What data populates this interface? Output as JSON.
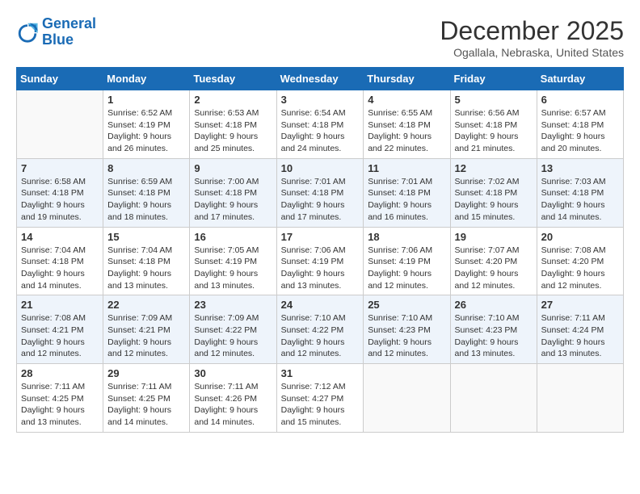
{
  "logo": {
    "line1": "General",
    "line2": "Blue"
  },
  "title": "December 2025",
  "location": "Ogallala, Nebraska, United States",
  "weekdays": [
    "Sunday",
    "Monday",
    "Tuesday",
    "Wednesday",
    "Thursday",
    "Friday",
    "Saturday"
  ],
  "weeks": [
    [
      {
        "day": "",
        "sunrise": "",
        "sunset": "",
        "daylight": ""
      },
      {
        "day": "1",
        "sunrise": "Sunrise: 6:52 AM",
        "sunset": "Sunset: 4:19 PM",
        "daylight": "Daylight: 9 hours and 26 minutes."
      },
      {
        "day": "2",
        "sunrise": "Sunrise: 6:53 AM",
        "sunset": "Sunset: 4:18 PM",
        "daylight": "Daylight: 9 hours and 25 minutes."
      },
      {
        "day": "3",
        "sunrise": "Sunrise: 6:54 AM",
        "sunset": "Sunset: 4:18 PM",
        "daylight": "Daylight: 9 hours and 24 minutes."
      },
      {
        "day": "4",
        "sunrise": "Sunrise: 6:55 AM",
        "sunset": "Sunset: 4:18 PM",
        "daylight": "Daylight: 9 hours and 22 minutes."
      },
      {
        "day": "5",
        "sunrise": "Sunrise: 6:56 AM",
        "sunset": "Sunset: 4:18 PM",
        "daylight": "Daylight: 9 hours and 21 minutes."
      },
      {
        "day": "6",
        "sunrise": "Sunrise: 6:57 AM",
        "sunset": "Sunset: 4:18 PM",
        "daylight": "Daylight: 9 hours and 20 minutes."
      }
    ],
    [
      {
        "day": "7",
        "sunrise": "Sunrise: 6:58 AM",
        "sunset": "Sunset: 4:18 PM",
        "daylight": "Daylight: 9 hours and 19 minutes."
      },
      {
        "day": "8",
        "sunrise": "Sunrise: 6:59 AM",
        "sunset": "Sunset: 4:18 PM",
        "daylight": "Daylight: 9 hours and 18 minutes."
      },
      {
        "day": "9",
        "sunrise": "Sunrise: 7:00 AM",
        "sunset": "Sunset: 4:18 PM",
        "daylight": "Daylight: 9 hours and 17 minutes."
      },
      {
        "day": "10",
        "sunrise": "Sunrise: 7:01 AM",
        "sunset": "Sunset: 4:18 PM",
        "daylight": "Daylight: 9 hours and 17 minutes."
      },
      {
        "day": "11",
        "sunrise": "Sunrise: 7:01 AM",
        "sunset": "Sunset: 4:18 PM",
        "daylight": "Daylight: 9 hours and 16 minutes."
      },
      {
        "day": "12",
        "sunrise": "Sunrise: 7:02 AM",
        "sunset": "Sunset: 4:18 PM",
        "daylight": "Daylight: 9 hours and 15 minutes."
      },
      {
        "day": "13",
        "sunrise": "Sunrise: 7:03 AM",
        "sunset": "Sunset: 4:18 PM",
        "daylight": "Daylight: 9 hours and 14 minutes."
      }
    ],
    [
      {
        "day": "14",
        "sunrise": "Sunrise: 7:04 AM",
        "sunset": "Sunset: 4:18 PM",
        "daylight": "Daylight: 9 hours and 14 minutes."
      },
      {
        "day": "15",
        "sunrise": "Sunrise: 7:04 AM",
        "sunset": "Sunset: 4:18 PM",
        "daylight": "Daylight: 9 hours and 13 minutes."
      },
      {
        "day": "16",
        "sunrise": "Sunrise: 7:05 AM",
        "sunset": "Sunset: 4:19 PM",
        "daylight": "Daylight: 9 hours and 13 minutes."
      },
      {
        "day": "17",
        "sunrise": "Sunrise: 7:06 AM",
        "sunset": "Sunset: 4:19 PM",
        "daylight": "Daylight: 9 hours and 13 minutes."
      },
      {
        "day": "18",
        "sunrise": "Sunrise: 7:06 AM",
        "sunset": "Sunset: 4:19 PM",
        "daylight": "Daylight: 9 hours and 12 minutes."
      },
      {
        "day": "19",
        "sunrise": "Sunrise: 7:07 AM",
        "sunset": "Sunset: 4:20 PM",
        "daylight": "Daylight: 9 hours and 12 minutes."
      },
      {
        "day": "20",
        "sunrise": "Sunrise: 7:08 AM",
        "sunset": "Sunset: 4:20 PM",
        "daylight": "Daylight: 9 hours and 12 minutes."
      }
    ],
    [
      {
        "day": "21",
        "sunrise": "Sunrise: 7:08 AM",
        "sunset": "Sunset: 4:21 PM",
        "daylight": "Daylight: 9 hours and 12 minutes."
      },
      {
        "day": "22",
        "sunrise": "Sunrise: 7:09 AM",
        "sunset": "Sunset: 4:21 PM",
        "daylight": "Daylight: 9 hours and 12 minutes."
      },
      {
        "day": "23",
        "sunrise": "Sunrise: 7:09 AM",
        "sunset": "Sunset: 4:22 PM",
        "daylight": "Daylight: 9 hours and 12 minutes."
      },
      {
        "day": "24",
        "sunrise": "Sunrise: 7:10 AM",
        "sunset": "Sunset: 4:22 PM",
        "daylight": "Daylight: 9 hours and 12 minutes."
      },
      {
        "day": "25",
        "sunrise": "Sunrise: 7:10 AM",
        "sunset": "Sunset: 4:23 PM",
        "daylight": "Daylight: 9 hours and 12 minutes."
      },
      {
        "day": "26",
        "sunrise": "Sunrise: 7:10 AM",
        "sunset": "Sunset: 4:23 PM",
        "daylight": "Daylight: 9 hours and 13 minutes."
      },
      {
        "day": "27",
        "sunrise": "Sunrise: 7:11 AM",
        "sunset": "Sunset: 4:24 PM",
        "daylight": "Daylight: 9 hours and 13 minutes."
      }
    ],
    [
      {
        "day": "28",
        "sunrise": "Sunrise: 7:11 AM",
        "sunset": "Sunset: 4:25 PM",
        "daylight": "Daylight: 9 hours and 13 minutes."
      },
      {
        "day": "29",
        "sunrise": "Sunrise: 7:11 AM",
        "sunset": "Sunset: 4:25 PM",
        "daylight": "Daylight: 9 hours and 14 minutes."
      },
      {
        "day": "30",
        "sunrise": "Sunrise: 7:11 AM",
        "sunset": "Sunset: 4:26 PM",
        "daylight": "Daylight: 9 hours and 14 minutes."
      },
      {
        "day": "31",
        "sunrise": "Sunrise: 7:12 AM",
        "sunset": "Sunset: 4:27 PM",
        "daylight": "Daylight: 9 hours and 15 minutes."
      },
      {
        "day": "",
        "sunrise": "",
        "sunset": "",
        "daylight": ""
      },
      {
        "day": "",
        "sunrise": "",
        "sunset": "",
        "daylight": ""
      },
      {
        "day": "",
        "sunrise": "",
        "sunset": "",
        "daylight": ""
      }
    ]
  ]
}
